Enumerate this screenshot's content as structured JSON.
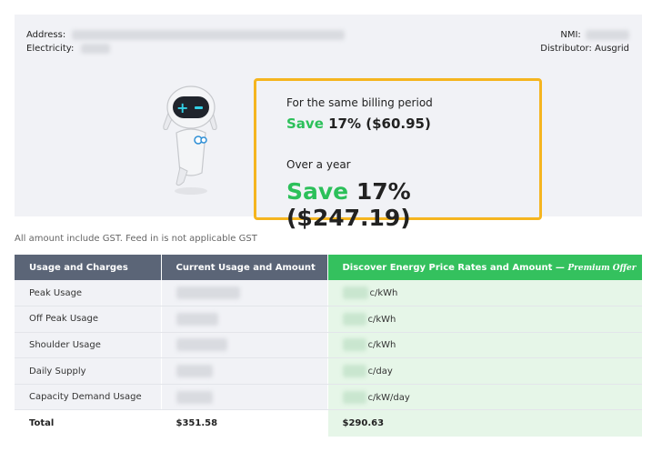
{
  "header": {
    "address_label": "Address:",
    "electricity_label": "Electricity:",
    "nmi_label": "NMI:",
    "distributor_label": "Distributor:",
    "distributor_value": "Ausgrid"
  },
  "savings": {
    "period_label": "For the same billing period",
    "save_word": "Save",
    "period_amount": "17% ($60.95)",
    "year_label": "Over a year",
    "year_amount": "17% ($247.19)"
  },
  "note": "All amount include GST. Feed in is not applicable GST",
  "table": {
    "headers": {
      "c1": "Usage and Charges",
      "c2": "Current Usage and Amount",
      "c3": "Discover Energy Price Rates and Amount —",
      "c3_premium": "Premium Offer"
    },
    "rows": [
      {
        "label": "Peak Usage",
        "unit": "c/kWh"
      },
      {
        "label": "Off Peak Usage",
        "unit": "c/kWh"
      },
      {
        "label": "Shoulder Usage",
        "unit": "c/kWh"
      },
      {
        "label": "Daily Supply",
        "unit": "c/day"
      },
      {
        "label": "Capacity Demand Usage",
        "unit": "c/kW/day"
      }
    ],
    "total": {
      "label": "Total",
      "current": "$351.58",
      "offer": "$290.63"
    }
  },
  "colors": {
    "accent_green": "#2cc05a",
    "highlight_border": "#f5b51f",
    "header_gray": "#5b6577"
  }
}
